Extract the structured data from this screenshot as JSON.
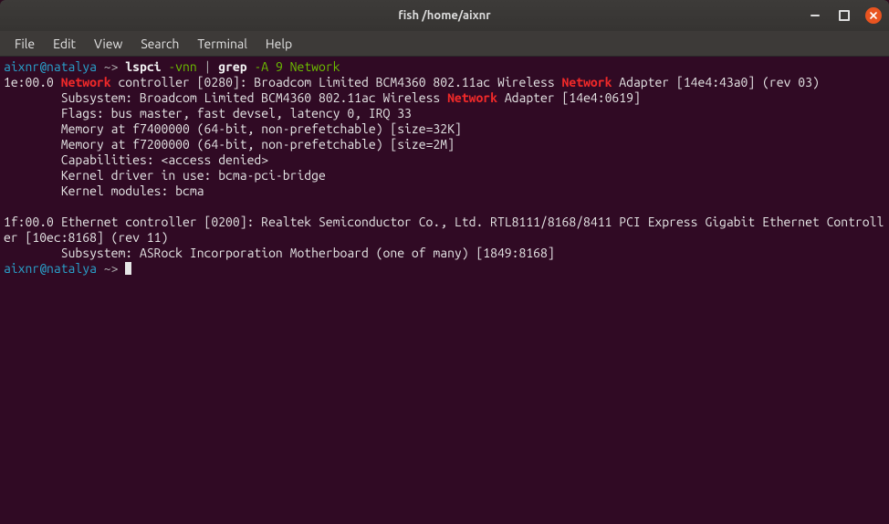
{
  "window": {
    "title": "fish  /home/aixnr"
  },
  "menubar": {
    "items": [
      "File",
      "Edit",
      "View",
      "Search",
      "Terminal",
      "Help"
    ]
  },
  "prompt": {
    "user_host": "aixnr@natalya",
    "arrow": " ~> ",
    "cmd_part1": "lspci",
    "cmd_flag1": " -vnn",
    "cmd_pipe": " | ",
    "cmd_part2": "grep",
    "cmd_flag2": " -A 9 Network"
  },
  "output": {
    "l1_a": "1e:00.0 ",
    "l1_net": "Network",
    "l1_b": " controller [0280]: Broadcom Limited BCM4360 802.11ac Wireless ",
    "l1_net2": "Network",
    "l1_c": " Adapter [14e4:43a0] (rev 03)",
    "l2_a": "        Subsystem: Broadcom Limited BCM4360 802.11ac Wireless ",
    "l2_net": "Network",
    "l2_b": " Adapter [14e4:0619]",
    "l3": "        Flags: bus master, fast devsel, latency 0, IRQ 33",
    "l4": "        Memory at f7400000 (64-bit, non-prefetchable) [size=32K]",
    "l5": "        Memory at f7200000 (64-bit, non-prefetchable) [size=2M]",
    "l6": "        Capabilities: <access denied>",
    "l7": "        Kernel driver in use: bcma-pci-bridge",
    "l8": "        Kernel modules: bcma",
    "blank": " ",
    "l9": "1f:00.0 Ethernet controller [0200]: Realtek Semiconductor Co., Ltd. RTL8111/8168/8411 PCI Express Gigabit Ethernet Controller [10ec:8168] (rev 11)",
    "l10": "        Subsystem: ASRock Incorporation Motherboard (one of many) [1849:8168]"
  }
}
